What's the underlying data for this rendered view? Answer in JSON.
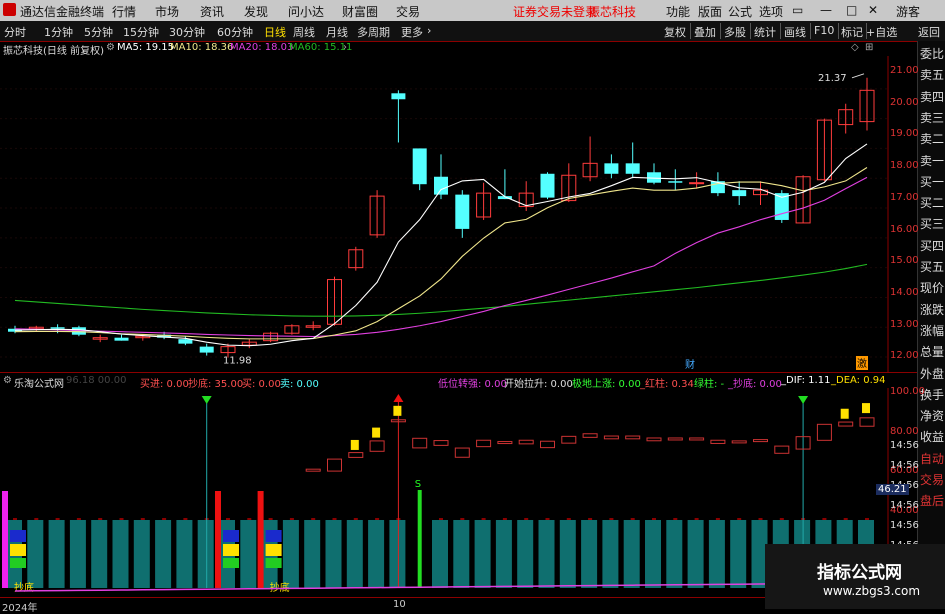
{
  "app": {
    "title": "通达信金融终端",
    "menu": [
      "行情",
      "市场",
      "资讯",
      "发现",
      "问小达",
      "财富圈",
      "交易"
    ],
    "status": "证券交易未登录",
    "stock_link": "振芯科技",
    "right_menu": [
      "功能",
      "版面",
      "公式",
      "选项"
    ],
    "user": "游客"
  },
  "toolbar": {
    "periods": [
      "分时",
      "1分钟",
      "5分钟",
      "15分钟",
      "30分钟",
      "60分钟",
      "日线",
      "周线",
      "月线",
      "多周期",
      "更多"
    ],
    "active_period": "日线",
    "tools": [
      "复权",
      "叠加",
      "多股",
      "统计",
      "画线",
      "F10",
      "标记",
      "+自选",
      "返回"
    ]
  },
  "info": {
    "stock": "振芯科技(日线 前复权)",
    "ma5": "MA5: 19.15",
    "ma10": "MA10: 18.36",
    "ma20": "MA20: 18.03",
    "ma60": "MA60: 15.11"
  },
  "colors": {
    "up": "#ff3c3c",
    "down": "#54ffff",
    "ma5": "#ffffff",
    "ma10": "#f0e68c",
    "ma20": "#e040e0",
    "ma60": "#22bb22"
  },
  "right_panel": [
    "委比",
    "卖五",
    "卖四",
    "卖三",
    "卖二",
    "卖一",
    "买一",
    "买二",
    "买三",
    "买四",
    "买五",
    "现价",
    "涨跌",
    "涨幅",
    "总量",
    "外盘",
    "换手",
    "净资",
    "收益",
    "自动",
    "交易",
    "盘后"
  ],
  "y_axis_main": [
    "21.00",
    "20.00",
    "19.00",
    "18.00",
    "17.00",
    "16.00",
    "15.00",
    "14.00",
    "13.00",
    "12.00"
  ],
  "y_axis_sub": [
    "100.00",
    "80.00",
    "60.00",
    "40.00"
  ],
  "time_labels": [
    "14:56",
    "14:56",
    "14:56",
    "14:56",
    "14:56",
    "14:56"
  ],
  "annotations": {
    "high": "21.37",
    "low": "11.98",
    "cai": "财",
    "ji": "激"
  },
  "sub_indicator": {
    "name": "乐淘公式网",
    "faded": "96.18 00.00",
    "buy_in": "买进: 0.00",
    "chaodi": "抄底: 35.00",
    "buy": "买: 0.00",
    "sell": "卖: 0.00",
    "low_strong": "低位转强: 0.00",
    "start_rise": "开始拉升: 0.00",
    "ground_rise": "极地上涨: 0.00",
    "red_bar": "_红柱: 0.34",
    "green_bar": "绿柱: -",
    "chaodi2": "_抄底: 0.00",
    "dif": "_DIF: 1.11",
    "dea": "_DEA: 0.94",
    "current_value": "46.21",
    "label_chaodi": "抄底",
    "label_s": "S"
  },
  "x_axis": [
    "2024年",
    "10"
  ],
  "watermark": {
    "title": "指标公式网",
    "url": "www.zbgs3.com"
  },
  "chart_data": {
    "type": "candlestick",
    "y_range": [
      11.7,
      21.9
    ],
    "candles": [
      {
        "o": 12.95,
        "h": 13.05,
        "l": 12.8,
        "c": 12.85
      },
      {
        "o": 12.95,
        "h": 13.05,
        "l": 12.85,
        "c": 13.0
      },
      {
        "o": 13.0,
        "h": 13.1,
        "l": 12.8,
        "c": 12.95
      },
      {
        "o": 13.0,
        "h": 13.05,
        "l": 12.7,
        "c": 12.75
      },
      {
        "o": 12.6,
        "h": 12.75,
        "l": 12.5,
        "c": 12.65
      },
      {
        "o": 12.65,
        "h": 12.75,
        "l": 12.55,
        "c": 12.55
      },
      {
        "o": 12.65,
        "h": 12.75,
        "l": 12.55,
        "c": 12.7
      },
      {
        "o": 12.75,
        "h": 12.85,
        "l": 12.6,
        "c": 12.65
      },
      {
        "o": 12.6,
        "h": 12.7,
        "l": 12.4,
        "c": 12.45
      },
      {
        "o": 12.35,
        "h": 12.45,
        "l": 12.05,
        "c": 12.15
      },
      {
        "o": 12.15,
        "h": 12.45,
        "l": 11.98,
        "c": 12.35
      },
      {
        "o": 12.4,
        "h": 12.6,
        "l": 12.3,
        "c": 12.5
      },
      {
        "o": 12.55,
        "h": 12.85,
        "l": 12.5,
        "c": 12.8
      },
      {
        "o": 12.8,
        "h": 13.1,
        "l": 12.75,
        "c": 13.05
      },
      {
        "o": 13.0,
        "h": 13.2,
        "l": 12.9,
        "c": 13.05
      },
      {
        "o": 13.1,
        "h": 14.7,
        "l": 13.05,
        "c": 14.6
      },
      {
        "o": 15.0,
        "h": 15.7,
        "l": 14.9,
        "c": 15.6
      },
      {
        "o": 16.1,
        "h": 17.6,
        "l": 16.0,
        "c": 17.4
      },
      {
        "o": 20.85,
        "h": 20.95,
        "l": 19.2,
        "c": 20.65
      },
      {
        "o": 19.0,
        "h": 19.0,
        "l": 17.6,
        "c": 17.8
      },
      {
        "o": 18.05,
        "h": 18.8,
        "l": 17.3,
        "c": 17.45
      },
      {
        "o": 17.45,
        "h": 17.6,
        "l": 16.0,
        "c": 16.3
      },
      {
        "o": 16.7,
        "h": 17.85,
        "l": 16.6,
        "c": 17.5
      },
      {
        "o": 17.4,
        "h": 18.3,
        "l": 17.3,
        "c": 17.3
      },
      {
        "o": 17.05,
        "h": 17.9,
        "l": 16.9,
        "c": 17.5
      },
      {
        "o": 18.15,
        "h": 18.2,
        "l": 17.3,
        "c": 17.35
      },
      {
        "o": 17.25,
        "h": 18.5,
        "l": 17.2,
        "c": 18.1
      },
      {
        "o": 18.05,
        "h": 19.4,
        "l": 17.9,
        "c": 18.5
      },
      {
        "o": 18.5,
        "h": 18.8,
        "l": 18.0,
        "c": 18.15
      },
      {
        "o": 18.5,
        "h": 19.2,
        "l": 18.0,
        "c": 18.15
      },
      {
        "o": 18.2,
        "h": 18.5,
        "l": 17.8,
        "c": 17.85
      },
      {
        "o": 17.9,
        "h": 18.3,
        "l": 17.6,
        "c": 17.85
      },
      {
        "o": 17.85,
        "h": 18.2,
        "l": 17.65,
        "c": 17.85
      },
      {
        "o": 17.9,
        "h": 18.2,
        "l": 17.4,
        "c": 17.5
      },
      {
        "o": 17.6,
        "h": 17.9,
        "l": 17.1,
        "c": 17.4
      },
      {
        "o": 17.45,
        "h": 17.9,
        "l": 17.1,
        "c": 17.6
      },
      {
        "o": 17.5,
        "h": 17.6,
        "l": 16.5,
        "c": 16.6
      },
      {
        "o": 16.5,
        "h": 18.1,
        "l": 16.5,
        "c": 18.05
      },
      {
        "o": 17.95,
        "h": 20.0,
        "l": 17.9,
        "c": 19.95
      },
      {
        "o": 19.8,
        "h": 20.5,
        "l": 19.5,
        "c": 20.3
      },
      {
        "o": 19.9,
        "h": 21.37,
        "l": 19.6,
        "c": 20.95
      }
    ],
    "ma5": [
      12.9,
      12.92,
      12.93,
      12.92,
      12.85,
      12.77,
      12.72,
      12.67,
      12.63,
      12.5,
      12.4,
      12.38,
      12.43,
      12.55,
      12.63,
      13.12,
      13.73,
      14.51,
      15.86,
      16.61,
      17.62,
      17.91,
      17.96,
      17.38,
      17.08,
      17.22,
      17.37,
      17.49,
      17.75,
      18.03,
      18.0,
      17.98,
      18.02,
      17.86,
      17.68,
      17.63,
      17.36,
      17.53,
      17.86,
      18.66,
      19.15
    ],
    "ma10": [
      12.85,
      12.86,
      12.86,
      12.85,
      12.82,
      12.78,
      12.76,
      12.73,
      12.7,
      12.66,
      12.63,
      12.61,
      12.61,
      12.61,
      12.62,
      12.74,
      12.88,
      13.19,
      13.62,
      14.05,
      14.62,
      15.38,
      15.99,
      16.5,
      16.62,
      17.01,
      17.32,
      17.44,
      17.56,
      17.67,
      17.6,
      17.6,
      17.67,
      17.82,
      17.87,
      17.87,
      17.75,
      17.58,
      17.71,
      17.91,
      18.36
    ],
    "ma20": [
      12.95,
      12.93,
      12.91,
      12.89,
      12.87,
      12.85,
      12.83,
      12.81,
      12.79,
      12.76,
      12.74,
      12.72,
      12.71,
      12.7,
      12.69,
      12.72,
      12.76,
      12.83,
      12.93,
      13.05,
      13.19,
      13.36,
      13.53,
      13.73,
      13.9,
      14.08,
      14.27,
      14.46,
      14.65,
      14.86,
      15.06,
      15.48,
      15.84,
      16.16,
      16.37,
      16.61,
      16.81,
      17.0,
      17.26,
      17.65,
      18.03
    ],
    "ma60": [
      13.9,
      13.85,
      13.8,
      13.75,
      13.7,
      13.65,
      13.6,
      13.56,
      13.52,
      13.48,
      13.45,
      13.42,
      13.4,
      13.38,
      13.37,
      13.37,
      13.38,
      13.4,
      13.43,
      13.47,
      13.52,
      13.58,
      13.64,
      13.7,
      13.77,
      13.84,
      13.91,
      13.98,
      14.05,
      14.12,
      14.19,
      14.26,
      14.33,
      14.41,
      14.49,
      14.57,
      14.66,
      14.75,
      14.85,
      14.97,
      15.11
    ]
  }
}
